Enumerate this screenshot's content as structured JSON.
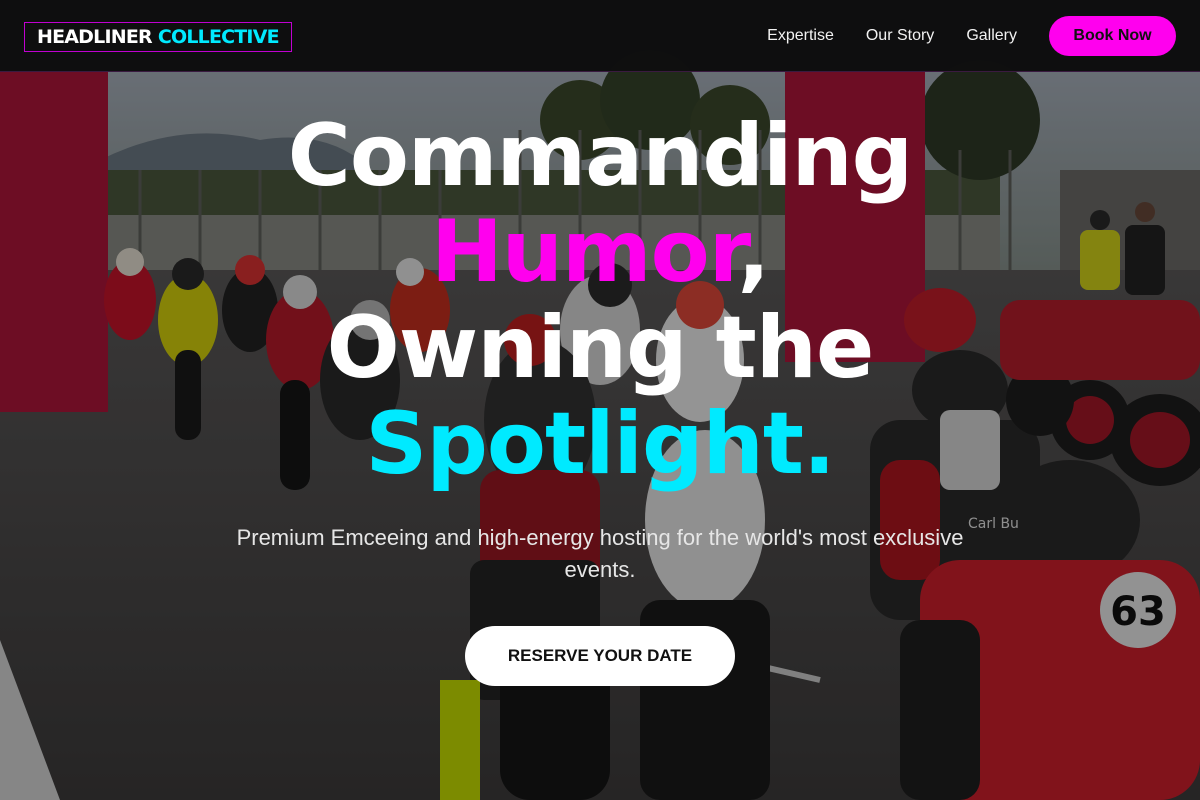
{
  "header": {
    "logo_primary": "HEADLINER",
    "logo_accent": "COLLECTIVE",
    "nav_items": [
      {
        "label": "Expertise"
      },
      {
        "label": "Our Story"
      },
      {
        "label": "Gallery"
      }
    ],
    "book_button": "Book Now"
  },
  "hero": {
    "headline": {
      "line1": "Commanding",
      "line2_highlight": "Humor",
      "line2_tail": ",",
      "line3": "Owning the",
      "line4_highlight": "Spotlight",
      "line4_tail": "."
    },
    "subtitle": "Premium Emceeing and high-energy hosting for the world's most exclusive events.",
    "cta_label": "RESERVE YOUR DATE",
    "background_label": "motorcycle-race-grid-photo",
    "rider_number": "63",
    "rider_name_patch": "Carl Bu"
  },
  "colors": {
    "magenta": "#ff00ee",
    "cyan": "#00eaff",
    "header_bg": "#0e0e10",
    "cta_bg": "#ffffff"
  }
}
